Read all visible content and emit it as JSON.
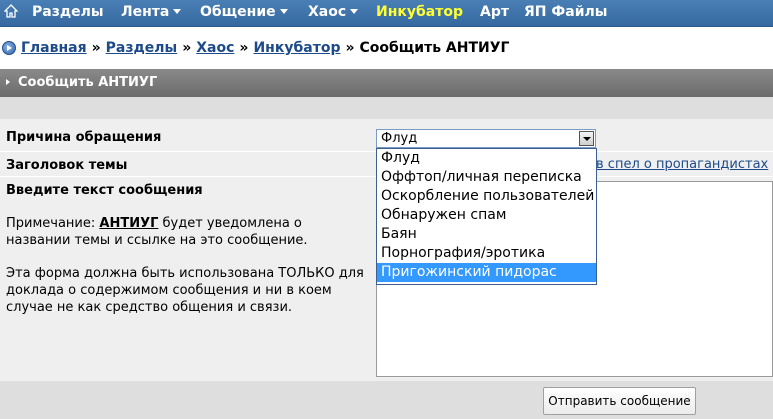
{
  "navbar": {
    "home_icon": "home-icon",
    "items": [
      {
        "label": "Разделы",
        "has_menu": false,
        "active": false
      },
      {
        "label": "Лента",
        "has_menu": true,
        "active": false
      },
      {
        "label": "Общение",
        "has_menu": true,
        "active": false
      },
      {
        "label": "Хаос",
        "has_menu": true,
        "active": false
      },
      {
        "label": "Инкубатор",
        "has_menu": false,
        "active": true
      },
      {
        "label": "Арт",
        "has_menu": false,
        "active": false
      },
      {
        "label": "ЯП Файлы",
        "has_menu": false,
        "active": false
      }
    ],
    "colors": {
      "bar": "#3a6ea5",
      "active_text": "#ffff33",
      "text": "#ffffff"
    }
  },
  "breadcrumb": {
    "icon": "arrow-circle-icon",
    "links": [
      "Главная",
      "Разделы",
      "Хаос",
      "Инкубатор"
    ],
    "separator": "»",
    "current": "Сообщить АНТИУГ"
  },
  "section": {
    "title": "Сообщить АНТИУГ",
    "icon": "triangle-right-icon"
  },
  "form": {
    "reason_label": "Причина обращения",
    "reason_selected": "Флуд",
    "reason_options": [
      "Флуд",
      "Оффтоп/личная переписка",
      "Оскорбление пользователей",
      "Обнаружен спам",
      "Баян",
      "Порнография/эротика",
      "Пригожинский пидорас"
    ],
    "highlighted_option_index": 6,
    "topic_label": "Заголовок темы",
    "topic_value_visible": "в спел о пропагандистах",
    "message_label": "Введите текст сообщения",
    "note_prefix": "Примечание: ",
    "note_user": "АНТИУГ",
    "note_suffix": " будет уведомлена о названии темы и ссылке на это сообщение.",
    "warning": "Эта форма должна быть использована ТОЛЬКО для доклада о содержимом сообщения и ни в коем случае не как средство общения и связи.",
    "message_value": "",
    "submit_label": "Отправить сообщение"
  }
}
